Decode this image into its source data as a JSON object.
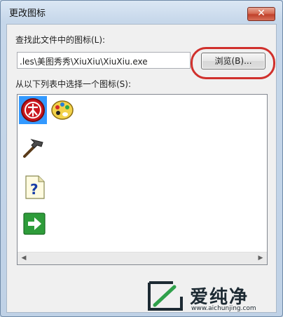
{
  "window": {
    "title": "更改图标",
    "close_glyph": "✕"
  },
  "dialog": {
    "find_label": "查找此文件中的图标(L):",
    "path_value": ".les\\美图秀秀\\XiuXiu\\XiuXiu.exe",
    "browse_label": "浏览(B)...",
    "list_label": "从以下列表中选择一个图标(S):",
    "icons": [
      "meitu-xiuxiu-icon",
      "palette-icon",
      "hammer-icon",
      "help-document-icon",
      "green-arrow-icon"
    ],
    "selected_icon": "meitu-xiuxiu-icon"
  },
  "annotation": {
    "color": "#d0302c"
  },
  "watermark": {
    "text": "爱纯净",
    "url": "www.aichunjing.com"
  }
}
